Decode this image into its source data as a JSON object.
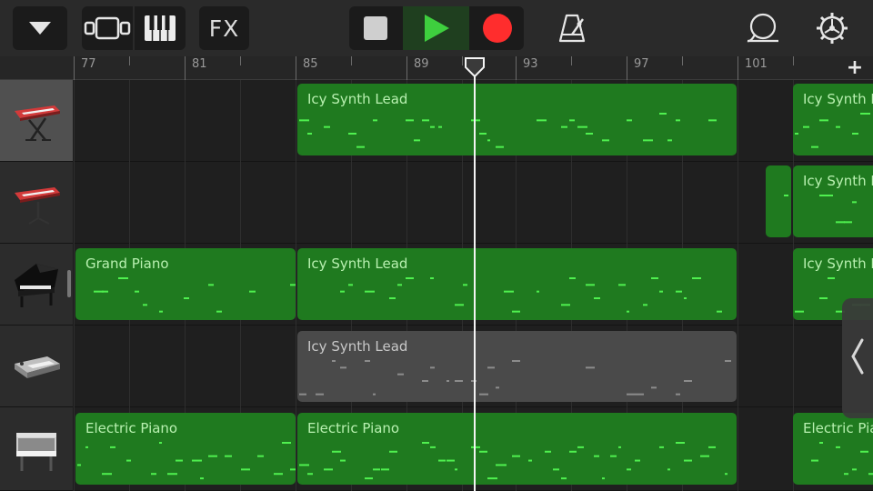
{
  "toolbar": {
    "browser_button": "chevron-down-icon",
    "tracks_view_button": "tracks-view-icon",
    "keyboard_button": "piano-keys-icon",
    "fx_label": "FX",
    "stop_button": "stop-icon",
    "play_button": "play-icon",
    "record_button": "record-icon",
    "metronome_button": "metronome-icon",
    "loop_button": "loop-icon",
    "settings_button": "gear-icon"
  },
  "ruler": {
    "bars": [
      "77",
      "81",
      "85",
      "89",
      "93",
      "97",
      "101"
    ],
    "add_track_label": "+"
  },
  "tracks": [
    {
      "instrument": "keyboard-on-stand-icon",
      "selected": true,
      "regions": [
        {
          "name": "Icy Synth Lead",
          "color": "green"
        },
        {
          "name": "Icy Synth Lead",
          "color": "green"
        }
      ]
    },
    {
      "instrument": "keyboard-on-stand-icon",
      "selected": false,
      "regions": [
        {
          "name": "",
          "color": "green"
        },
        {
          "name": "Icy Synth Lead",
          "color": "green"
        }
      ]
    },
    {
      "instrument": "grand-piano-icon",
      "selected": false,
      "regions": [
        {
          "name": "Grand Piano",
          "color": "green"
        },
        {
          "name": "Icy Synth Lead",
          "color": "green"
        },
        {
          "name": "Icy Synth Lead",
          "color": "green"
        }
      ]
    },
    {
      "instrument": "synth-module-icon",
      "selected": false,
      "regions": [
        {
          "name": "Icy Synth Lead",
          "color": "gray"
        }
      ]
    },
    {
      "instrument": "electric-piano-icon",
      "selected": false,
      "regions": [
        {
          "name": "Electric Piano",
          "color": "green"
        },
        {
          "name": "Electric Piano",
          "color": "green"
        },
        {
          "name": "Electric Piano",
          "color": "green"
        }
      ]
    }
  ],
  "colors": {
    "region_green": "#1f7a1f",
    "note_green": "#4ff04f",
    "region_gray": "#4a4a4a",
    "play_green": "#3ecf3e",
    "record_red": "#ff2d2d"
  },
  "side_panel_handle": "chevron-left-icon"
}
